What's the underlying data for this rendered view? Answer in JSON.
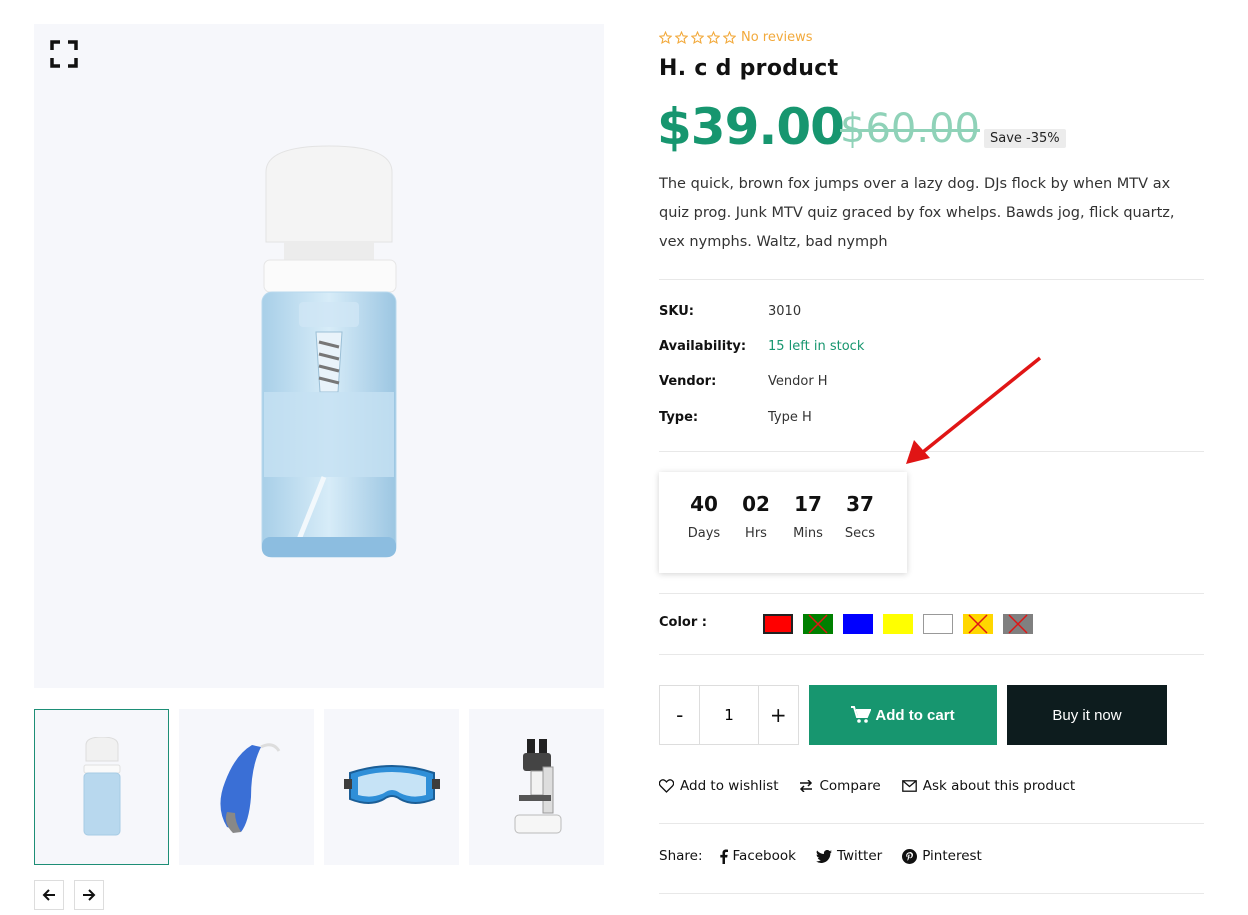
{
  "rating": {
    "stars": 5,
    "filled": 0,
    "reviews_text": "No reviews"
  },
  "product": {
    "title": "H. c d product",
    "price": "$39.00",
    "compare_price": "$60.00",
    "save_badge": "Save -35%",
    "description": "The quick, brown fox jumps over a lazy dog. DJs flock by when MTV ax quiz prog. Junk MTV quiz graced by fox whelps. Bawds jog, flick quartz, vex nymphs. Waltz, bad nymph"
  },
  "meta": [
    {
      "label": "SKU:",
      "value": "3010"
    },
    {
      "label": "Availability:",
      "value": "15 left in stock"
    },
    {
      "label": "Vendor:",
      "value": "Vendor H"
    },
    {
      "label": "Type:",
      "value": "Type H"
    }
  ],
  "countdown": [
    {
      "value": "40",
      "label": "Days"
    },
    {
      "value": "02",
      "label": "Hrs"
    },
    {
      "value": "17",
      "label": "Mins"
    },
    {
      "value": "37",
      "label": "Secs"
    }
  ],
  "color": {
    "label": "Color :",
    "swatches": [
      {
        "color": "#ff0000",
        "selected": true,
        "available": true
      },
      {
        "color": "#008000",
        "selected": false,
        "available": false
      },
      {
        "color": "#0000ff",
        "selected": false,
        "available": true
      },
      {
        "color": "#ffff00",
        "selected": false,
        "available": true
      },
      {
        "color": "#ffffff",
        "selected": false,
        "available": true
      },
      {
        "color": "#ffd700",
        "selected": false,
        "available": false
      },
      {
        "color": "#808080",
        "selected": false,
        "available": false
      }
    ]
  },
  "quantity": {
    "minus": "-",
    "value": "1",
    "plus": "+"
  },
  "buttons": {
    "add_to_cart": "Add to cart",
    "buy_now": "Buy it now"
  },
  "actions": {
    "wishlist": "Add to wishlist",
    "compare": "Compare",
    "ask": "Ask about this product"
  },
  "share": {
    "label": "Share:",
    "facebook": "Facebook",
    "twitter": "Twitter",
    "pinterest": "Pinterest"
  },
  "colors": {
    "accent": "#17966f",
    "dark": "#0d1c1e",
    "star": "#f2a93b",
    "annotation_arrow": "#e01515"
  },
  "gallery": {
    "thumbnails": [
      "foam-pump-bottle",
      "hearing-aid",
      "safety-goggles",
      "microscope"
    ],
    "active_thumbnail": 0
  }
}
